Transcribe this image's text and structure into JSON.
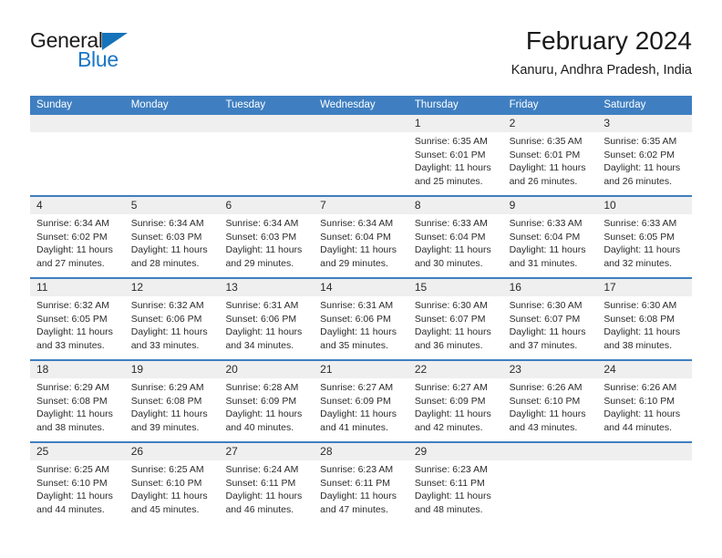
{
  "brand": {
    "line1": "General",
    "line2": "Blue",
    "accent_color": "#1976c7"
  },
  "header": {
    "title": "February 2024",
    "subtitle": "Kanuru, Andhra Pradesh, India"
  },
  "calendar": {
    "header_color": "#3f7fc1",
    "weekdays": [
      "Sunday",
      "Monday",
      "Tuesday",
      "Wednesday",
      "Thursday",
      "Friday",
      "Saturday"
    ],
    "weeks": [
      [
        {
          "day": "",
          "empty": true
        },
        {
          "day": "",
          "empty": true
        },
        {
          "day": "",
          "empty": true
        },
        {
          "day": "",
          "empty": true
        },
        {
          "day": "1",
          "sunrise": "Sunrise: 6:35 AM",
          "sunset": "Sunset: 6:01 PM",
          "daylight1": "Daylight: 11 hours",
          "daylight2": "and 25 minutes."
        },
        {
          "day": "2",
          "sunrise": "Sunrise: 6:35 AM",
          "sunset": "Sunset: 6:01 PM",
          "daylight1": "Daylight: 11 hours",
          "daylight2": "and 26 minutes."
        },
        {
          "day": "3",
          "sunrise": "Sunrise: 6:35 AM",
          "sunset": "Sunset: 6:02 PM",
          "daylight1": "Daylight: 11 hours",
          "daylight2": "and 26 minutes."
        }
      ],
      [
        {
          "day": "4",
          "sunrise": "Sunrise: 6:34 AM",
          "sunset": "Sunset: 6:02 PM",
          "daylight1": "Daylight: 11 hours",
          "daylight2": "and 27 minutes."
        },
        {
          "day": "5",
          "sunrise": "Sunrise: 6:34 AM",
          "sunset": "Sunset: 6:03 PM",
          "daylight1": "Daylight: 11 hours",
          "daylight2": "and 28 minutes."
        },
        {
          "day": "6",
          "sunrise": "Sunrise: 6:34 AM",
          "sunset": "Sunset: 6:03 PM",
          "daylight1": "Daylight: 11 hours",
          "daylight2": "and 29 minutes."
        },
        {
          "day": "7",
          "sunrise": "Sunrise: 6:34 AM",
          "sunset": "Sunset: 6:04 PM",
          "daylight1": "Daylight: 11 hours",
          "daylight2": "and 29 minutes."
        },
        {
          "day": "8",
          "sunrise": "Sunrise: 6:33 AM",
          "sunset": "Sunset: 6:04 PM",
          "daylight1": "Daylight: 11 hours",
          "daylight2": "and 30 minutes."
        },
        {
          "day": "9",
          "sunrise": "Sunrise: 6:33 AM",
          "sunset": "Sunset: 6:04 PM",
          "daylight1": "Daylight: 11 hours",
          "daylight2": "and 31 minutes."
        },
        {
          "day": "10",
          "sunrise": "Sunrise: 6:33 AM",
          "sunset": "Sunset: 6:05 PM",
          "daylight1": "Daylight: 11 hours",
          "daylight2": "and 32 minutes."
        }
      ],
      [
        {
          "day": "11",
          "sunrise": "Sunrise: 6:32 AM",
          "sunset": "Sunset: 6:05 PM",
          "daylight1": "Daylight: 11 hours",
          "daylight2": "and 33 minutes."
        },
        {
          "day": "12",
          "sunrise": "Sunrise: 6:32 AM",
          "sunset": "Sunset: 6:06 PM",
          "daylight1": "Daylight: 11 hours",
          "daylight2": "and 33 minutes."
        },
        {
          "day": "13",
          "sunrise": "Sunrise: 6:31 AM",
          "sunset": "Sunset: 6:06 PM",
          "daylight1": "Daylight: 11 hours",
          "daylight2": "and 34 minutes."
        },
        {
          "day": "14",
          "sunrise": "Sunrise: 6:31 AM",
          "sunset": "Sunset: 6:06 PM",
          "daylight1": "Daylight: 11 hours",
          "daylight2": "and 35 minutes."
        },
        {
          "day": "15",
          "sunrise": "Sunrise: 6:30 AM",
          "sunset": "Sunset: 6:07 PM",
          "daylight1": "Daylight: 11 hours",
          "daylight2": "and 36 minutes."
        },
        {
          "day": "16",
          "sunrise": "Sunrise: 6:30 AM",
          "sunset": "Sunset: 6:07 PM",
          "daylight1": "Daylight: 11 hours",
          "daylight2": "and 37 minutes."
        },
        {
          "day": "17",
          "sunrise": "Sunrise: 6:30 AM",
          "sunset": "Sunset: 6:08 PM",
          "daylight1": "Daylight: 11 hours",
          "daylight2": "and 38 minutes."
        }
      ],
      [
        {
          "day": "18",
          "sunrise": "Sunrise: 6:29 AM",
          "sunset": "Sunset: 6:08 PM",
          "daylight1": "Daylight: 11 hours",
          "daylight2": "and 38 minutes."
        },
        {
          "day": "19",
          "sunrise": "Sunrise: 6:29 AM",
          "sunset": "Sunset: 6:08 PM",
          "daylight1": "Daylight: 11 hours",
          "daylight2": "and 39 minutes."
        },
        {
          "day": "20",
          "sunrise": "Sunrise: 6:28 AM",
          "sunset": "Sunset: 6:09 PM",
          "daylight1": "Daylight: 11 hours",
          "daylight2": "and 40 minutes."
        },
        {
          "day": "21",
          "sunrise": "Sunrise: 6:27 AM",
          "sunset": "Sunset: 6:09 PM",
          "daylight1": "Daylight: 11 hours",
          "daylight2": "and 41 minutes."
        },
        {
          "day": "22",
          "sunrise": "Sunrise: 6:27 AM",
          "sunset": "Sunset: 6:09 PM",
          "daylight1": "Daylight: 11 hours",
          "daylight2": "and 42 minutes."
        },
        {
          "day": "23",
          "sunrise": "Sunrise: 6:26 AM",
          "sunset": "Sunset: 6:10 PM",
          "daylight1": "Daylight: 11 hours",
          "daylight2": "and 43 minutes."
        },
        {
          "day": "24",
          "sunrise": "Sunrise: 6:26 AM",
          "sunset": "Sunset: 6:10 PM",
          "daylight1": "Daylight: 11 hours",
          "daylight2": "and 44 minutes."
        }
      ],
      [
        {
          "day": "25",
          "sunrise": "Sunrise: 6:25 AM",
          "sunset": "Sunset: 6:10 PM",
          "daylight1": "Daylight: 11 hours",
          "daylight2": "and 44 minutes."
        },
        {
          "day": "26",
          "sunrise": "Sunrise: 6:25 AM",
          "sunset": "Sunset: 6:10 PM",
          "daylight1": "Daylight: 11 hours",
          "daylight2": "and 45 minutes."
        },
        {
          "day": "27",
          "sunrise": "Sunrise: 6:24 AM",
          "sunset": "Sunset: 6:11 PM",
          "daylight1": "Daylight: 11 hours",
          "daylight2": "and 46 minutes."
        },
        {
          "day": "28",
          "sunrise": "Sunrise: 6:23 AM",
          "sunset": "Sunset: 6:11 PM",
          "daylight1": "Daylight: 11 hours",
          "daylight2": "and 47 minutes."
        },
        {
          "day": "29",
          "sunrise": "Sunrise: 6:23 AM",
          "sunset": "Sunset: 6:11 PM",
          "daylight1": "Daylight: 11 hours",
          "daylight2": "and 48 minutes."
        },
        {
          "day": "",
          "empty": true
        },
        {
          "day": "",
          "empty": true
        }
      ]
    ]
  }
}
